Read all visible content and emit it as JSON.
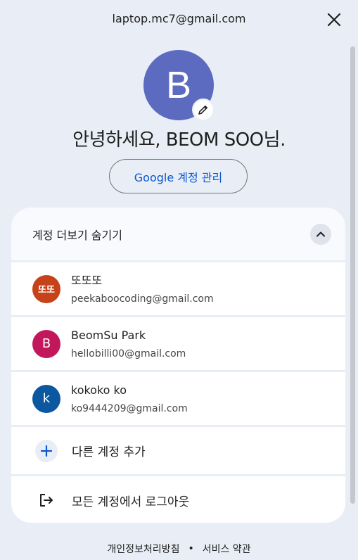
{
  "header": {
    "email": "laptop.mc7@gmail.com",
    "close_icon": "close-icon"
  },
  "profile": {
    "avatar_letter": "B",
    "avatar_color": "#5c6bc0",
    "greeting": "안녕하세요, BEOM SOO님.",
    "manage_button": "Google 계정 관리"
  },
  "accounts_panel": {
    "toggle_label": "계정 더보기 숨기기",
    "accounts": [
      {
        "avatar_text": "또또",
        "avatar_color": "#c5421b",
        "name": "또또또",
        "email": "peekaboocoding@gmail.com"
      },
      {
        "avatar_text": "B",
        "avatar_color": "#c2185b",
        "name": "BeomSu Park",
        "email": "hellobilli00@gmail.com"
      },
      {
        "avatar_text": "k",
        "avatar_color": "#0b57a0",
        "name": "kokoko ko",
        "email": "ko9444209@gmail.com"
      }
    ],
    "add_account_label": "다른 계정 추가",
    "sign_out_label": "모든 계정에서 로그아웃"
  },
  "footer": {
    "privacy": "개인정보처리방침",
    "separator": "•",
    "terms": "서비스 약관"
  },
  "colors": {
    "background": "#e9eef6",
    "accent_blue": "#0b57d0"
  }
}
